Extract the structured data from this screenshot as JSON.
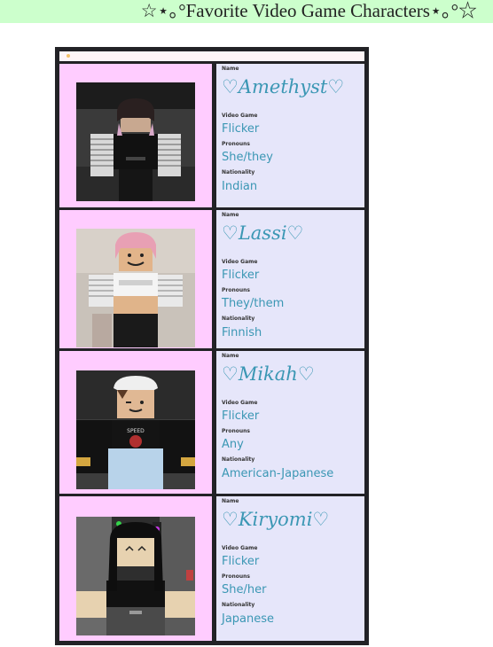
{
  "page": {
    "title": "☆⋆｡°Favorite Video Game Characters⋆｡°☆"
  },
  "labels": {
    "name": "Name",
    "game": "Video Game",
    "pronouns": "Pronouns",
    "nationality": "Nationality"
  },
  "characters": [
    {
      "name": "♡Amethyst♡",
      "game": "Flicker",
      "pronouns": "She/they",
      "nationality": "Indian"
    },
    {
      "name": "♡Lassi♡",
      "game": "Flicker",
      "pronouns": "They/them",
      "nationality": "Finnish"
    },
    {
      "name": "♡Mikah♡",
      "game": "Flicker",
      "pronouns": "Any",
      "nationality": "American-Japanese"
    },
    {
      "name": "♡Kiryomi♡",
      "game": "Flicker",
      "pronouns": "She/her",
      "nationality": "Japanese"
    }
  ],
  "colors": {
    "title_bg": "#ccffcc",
    "image_cell_bg": "#ffccff",
    "info_cell_bg": "#e6e6fa",
    "accent_text": "#3b97b4",
    "table_border": "#222226"
  }
}
